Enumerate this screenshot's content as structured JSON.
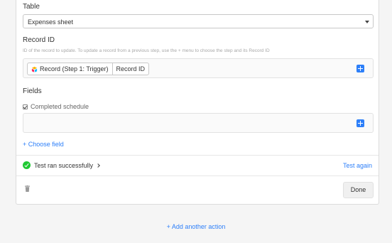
{
  "table": {
    "label": "Table",
    "selected": "Expenses sheet"
  },
  "record_id": {
    "label": "Record ID",
    "hint": "ID of the record to update. To update a record from a previous step, use the + menu to choose the step and its Record ID",
    "token_source": "Record (Step 1: Trigger)",
    "token_field": "Record ID",
    "token_icon": "airtable-logo-icon"
  },
  "fields": {
    "label": "Fields",
    "checkbox_label": "Completed schedule",
    "choose_field": "+ Choose field"
  },
  "test": {
    "status": "Test ran successfully",
    "again": "Test again"
  },
  "footer": {
    "done": "Done",
    "add_action": "+ Add another action"
  },
  "colors": {
    "accent": "#2d7ff9",
    "success": "#20c933"
  }
}
